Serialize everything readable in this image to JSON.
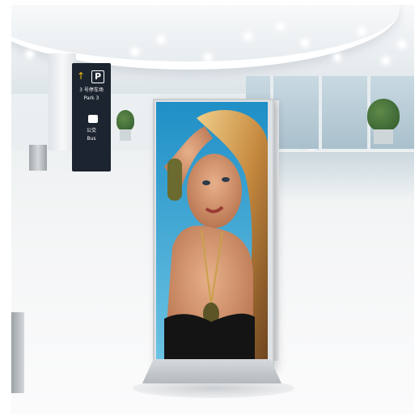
{
  "sign": {
    "parking_code": "3 号停车场",
    "parking_label": "Park 3",
    "bus_code": "公交",
    "bus_label": "Bus",
    "parking_symbol": "P"
  },
  "icons": [
    "up-arrow-icon",
    "parking-icon",
    "bus-icon"
  ],
  "colors": {
    "sign_bg": "#1c2430",
    "sign_arrow": "#f4c40f",
    "poster_sky": "#2a94c9",
    "stand_frame": "#dfe2e4"
  }
}
